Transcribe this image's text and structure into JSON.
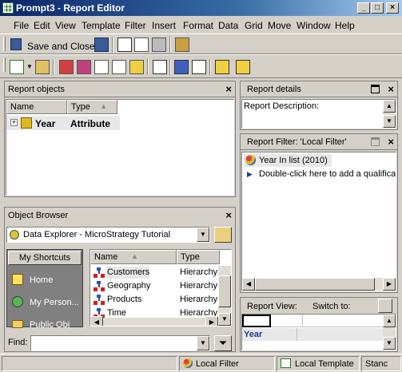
{
  "window": {
    "title": "Prompt3 - Report Editor"
  },
  "menu": [
    "File",
    "Edit",
    "View",
    "Template",
    "Filter",
    "Insert",
    "Format",
    "Data",
    "Grid",
    "Move",
    "Window",
    "Help"
  ],
  "toolbar1": {
    "save_close_label": "Save and Close"
  },
  "report_objects": {
    "title": "Report objects",
    "col_name": "Name",
    "col_type": "Type",
    "rows": [
      {
        "name": "Year",
        "type": "Attribute"
      }
    ]
  },
  "object_browser": {
    "title": "Object Browser",
    "dropdown_value": "Data Explorer - MicroStrategy Tutorial",
    "shortcuts_button": "My Shortcuts",
    "shortcuts": [
      "Home",
      "My Person...",
      "Public Obj"
    ],
    "col_name": "Name",
    "col_type": "Type",
    "items": [
      {
        "name": "Customers",
        "type": "Hierarchy"
      },
      {
        "name": "Geography",
        "type": "Hierarchy"
      },
      {
        "name": "Products",
        "type": "Hierarchy"
      },
      {
        "name": "Time",
        "type": "Hierarchy"
      }
    ],
    "find_label": "Find:",
    "find_value": ""
  },
  "report_details": {
    "title": "Report details",
    "description_label": "Report Description:"
  },
  "report_filter": {
    "title": "Report Filter: 'Local Filter'",
    "qualification": "Year In list (2010)",
    "add_hint": "Double-click here to add a qualificat"
  },
  "report_view": {
    "label": "Report View:",
    "switch_label": "Switch to:",
    "row_header": "Year"
  },
  "statusbar": {
    "filter": "Local Filter",
    "template": "Local Template",
    "status": "Stanc"
  },
  "colors": {
    "title_bar": "#0a246a",
    "selection": "#e8e8e8",
    "hierarchy_blue": "#1a3c8c"
  }
}
